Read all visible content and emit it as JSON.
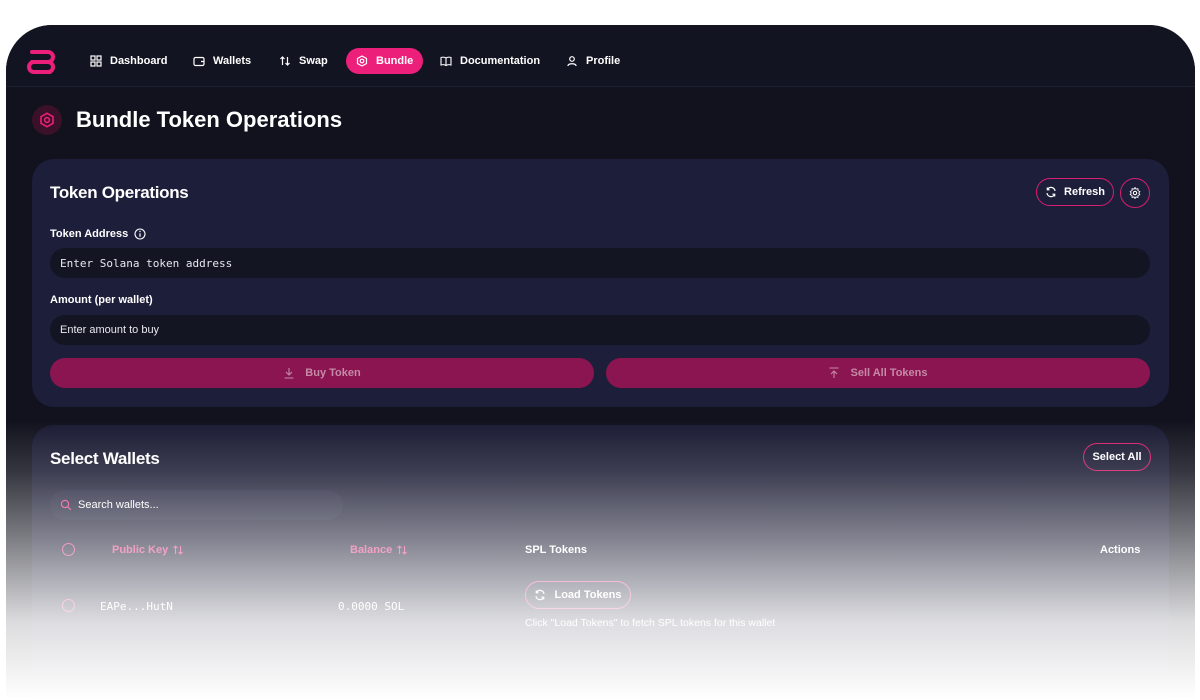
{
  "nav": {
    "items": [
      {
        "label": "Dashboard",
        "icon": "grid-icon"
      },
      {
        "label": "Wallets",
        "icon": "wallet-icon"
      },
      {
        "label": "Swap",
        "icon": "swap-arrows-icon"
      },
      {
        "label": "Bundle",
        "icon": "hexagon-icon",
        "active": true
      },
      {
        "label": "Documentation",
        "icon": "book-icon"
      },
      {
        "label": "Profile",
        "icon": "user-icon"
      }
    ]
  },
  "page": {
    "title": "Bundle Token Operations"
  },
  "token_ops": {
    "title": "Token Operations",
    "refresh_label": "Refresh",
    "token_address_label": "Token Address",
    "token_address_placeholder": "Enter Solana token address",
    "amount_label": "Amount (per wallet)",
    "amount_placeholder": "Enter amount to buy",
    "buy_label": "Buy Token",
    "sell_label": "Sell All Tokens"
  },
  "wallets": {
    "title": "Select Wallets",
    "select_all_label": "Select All",
    "search_placeholder": "Search wallets...",
    "columns": {
      "public_key": "Public Key",
      "balance": "Balance",
      "spl_tokens": "SPL Tokens",
      "actions": "Actions"
    },
    "rows": [
      {
        "public_key": "EAPe...HutN",
        "balance": "0.0000 SOL",
        "load_label": "Load Tokens",
        "hint": "Click \"Load Tokens\" to fetch SPL tokens for this wallet"
      }
    ]
  },
  "colors": {
    "accent": "#ec1f7a",
    "background": "#11121d",
    "card": "#1c1e3a"
  }
}
